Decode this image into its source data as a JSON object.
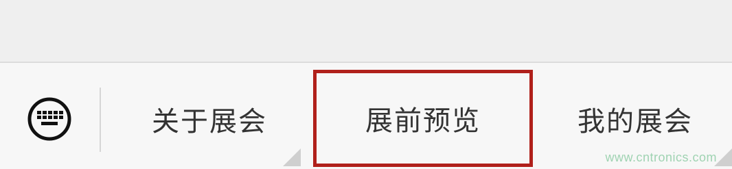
{
  "menu": {
    "keyboard_icon": "keyboard-icon",
    "items": [
      {
        "label": "关于展会",
        "selected": false
      },
      {
        "label": "展前预览",
        "selected": true
      },
      {
        "label": "我的展会",
        "selected": false
      }
    ]
  },
  "watermark": "www.cntronics.com",
  "colors": {
    "selection_border": "#b0201b",
    "text": "#333333",
    "watermark": "#9fd3b2"
  }
}
